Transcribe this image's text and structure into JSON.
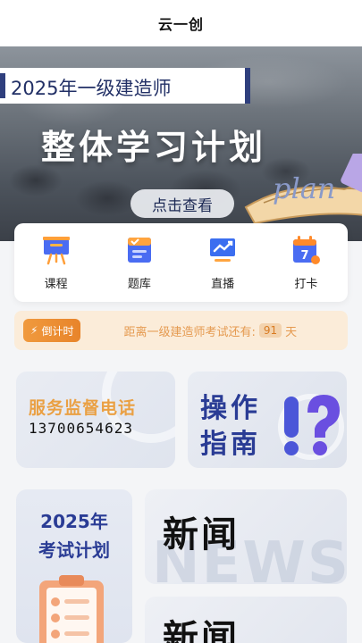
{
  "header": {
    "title": "云一创"
  },
  "banner": {
    "ribbon_text": "2025年一级建造师",
    "headline": "整体学习计划",
    "decor_word": "plan",
    "cta_label": "点击查看"
  },
  "quicknav": {
    "items": [
      {
        "label": "课程",
        "icon": "easel-icon"
      },
      {
        "label": "题库",
        "icon": "document-icon"
      },
      {
        "label": "直播",
        "icon": "monitor-chart-icon"
      },
      {
        "label": "打卡",
        "icon": "calendar-icon",
        "badge": "7"
      }
    ]
  },
  "countdown": {
    "tag_label": "倒计时",
    "prefix": "距离一级建造师考试还有:",
    "days": "91",
    "suffix": "天"
  },
  "service": {
    "title": "服务监督电话",
    "phone": "13700654623"
  },
  "guide": {
    "line1": "操作",
    "line2": "指南"
  },
  "plan": {
    "year": "2025年",
    "title": "考试计划"
  },
  "news": {
    "title": "新闻",
    "bg_word": "NEWS"
  },
  "colors": {
    "accent_blue": "#2a3c95",
    "accent_orange": "#eaa043",
    "countdown_bg": "#fbecd9"
  }
}
